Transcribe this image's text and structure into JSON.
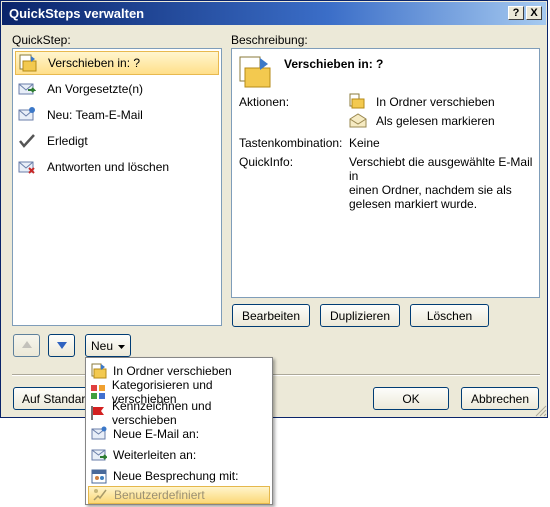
{
  "window": {
    "title": "QuickSteps verwalten",
    "help_label": "?",
    "close_label": "X"
  },
  "quickstep_label": "QuickStep:",
  "quicksteps": [
    {
      "label": "Verschieben in: ?",
      "icon": "move-to-folder-icon"
    },
    {
      "label": "An Vorgesetzte(n)",
      "icon": "forward-mail-icon"
    },
    {
      "label": "Neu: Team-E-Mail",
      "icon": "new-mail-icon"
    },
    {
      "label": "Erledigt",
      "icon": "checkmark-icon"
    },
    {
      "label": "Antworten und löschen",
      "icon": "reply-delete-icon"
    }
  ],
  "description": {
    "label": "Beschreibung:",
    "title": "Verschieben in: ?",
    "actions_label": "Aktionen:",
    "actions": [
      "In Ordner verschieben",
      "Als gelesen markieren"
    ],
    "shortcut_label": "Tastenkombination:",
    "shortcut_value": "Keine",
    "tooltip_label": "QuickInfo:",
    "tooltip_value": [
      "Verschiebt die ausgewählte E-Mail in",
      "einen Ordner, nachdem sie als",
      "gelesen markiert wurde."
    ]
  },
  "buttons": {
    "edit": "Bearbeiten",
    "duplicate": "Duplizieren",
    "delete": "Löschen",
    "new": "Neu",
    "reset": "Auf Standard",
    "ok": "OK",
    "cancel": "Abbrechen"
  },
  "new_menu": [
    {
      "label": "In Ordner verschieben",
      "icon": "move-to-folder-icon"
    },
    {
      "label": "Kategorisieren und verschieben",
      "icon": "categorize-icon"
    },
    {
      "label": "Kennzeichnen und verschieben",
      "icon": "flag-icon"
    },
    {
      "label": "Neue E-Mail an:",
      "icon": "new-mail-icon"
    },
    {
      "label": "Weiterleiten an:",
      "icon": "forward-mail-icon"
    },
    {
      "label": "Neue Besprechung mit:",
      "icon": "meeting-icon"
    },
    {
      "label": "Benutzerdefiniert",
      "icon": "custom-icon"
    }
  ],
  "colors": {
    "title_bar": "#0a246a",
    "dialog_face": "#ece9d8",
    "selection": "#ffdf8a"
  }
}
